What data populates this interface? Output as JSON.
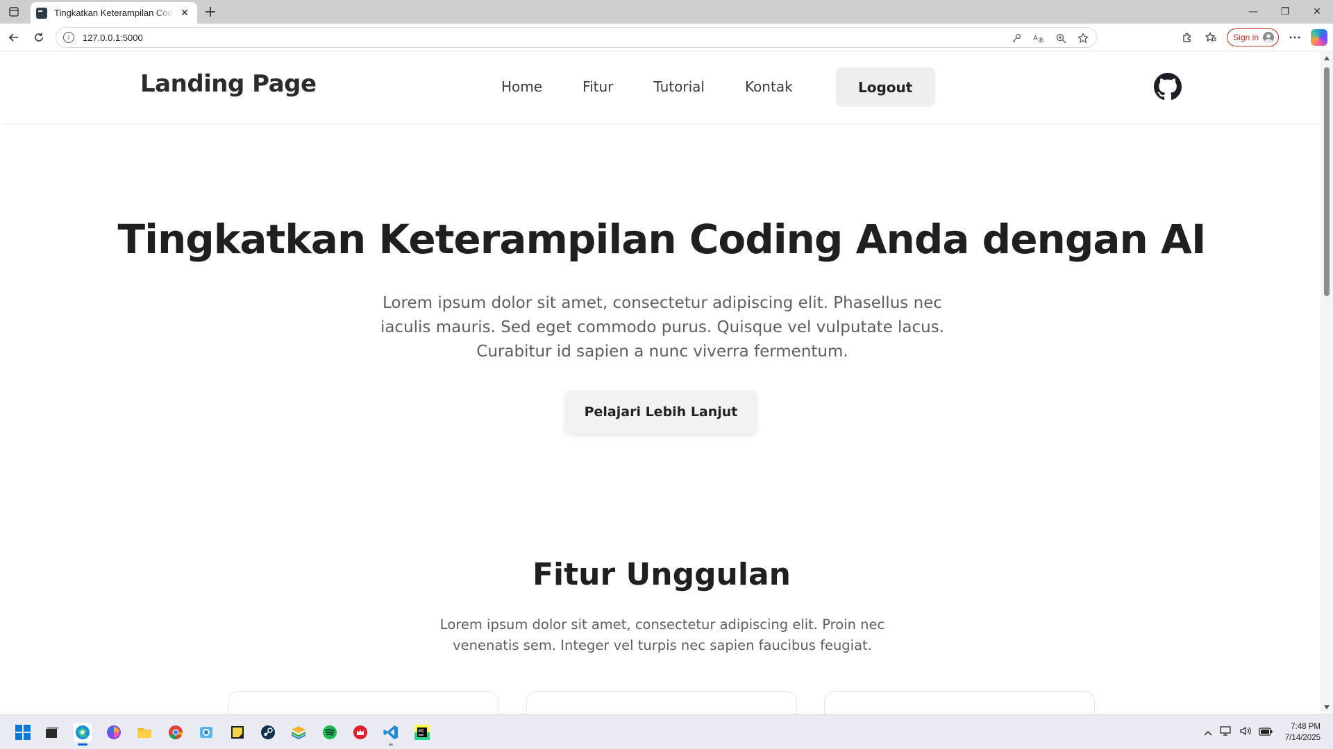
{
  "browser": {
    "tab_title": "Tingkatkan Keterampilan Coding Anda dengan AI",
    "url": "127.0.0.1:5000",
    "signin_label": "Sign in",
    "close_tab_glyph": "✕",
    "new_tab_glyph": "+",
    "window_controls": {
      "minimize": "—",
      "restore": "❐",
      "close": "✕"
    }
  },
  "site": {
    "logo": "Landing Page",
    "nav": {
      "home": "Home",
      "fitur": "Fitur",
      "tutorial": "Tutorial",
      "kontak": "Kontak",
      "logout": "Logout"
    },
    "github_icon": "github-icon"
  },
  "hero": {
    "title": "Tingkatkan Keterampilan Coding Anda dengan AI",
    "description": "Lorem ipsum dolor sit amet, consectetur adipiscing elit. Phasellus nec iaculis mauris. Sed eget commodo purus. Quisque vel vulputate lacus. Curabitur id sapien a nunc viverra fermentum.",
    "cta": "Pelajari Lebih Lanjut"
  },
  "features": {
    "title": "Fitur Unggulan",
    "description": "Lorem ipsum dolor sit amet, consectetur adipiscing elit. Proin nec venenatis sem. Integer vel turpis nec sapien faucibus feugiat."
  },
  "taskbar": {
    "time": "7:48 PM",
    "date": "7/14/2025",
    "apps": [
      "start",
      "file-explorer-window",
      "edge",
      "copilot",
      "folder",
      "chrome",
      "snipping-tool",
      "sticky-notes",
      "steam",
      "bluestacks",
      "spotify",
      "app-red",
      "vscode",
      "pycharm"
    ]
  },
  "colors": {
    "accent": "#0a5fd0",
    "signin_red": "#c42b1c",
    "logout_bg": "#efefef",
    "heading": "#1f1f1f",
    "body_text": "#5e5e5e"
  }
}
